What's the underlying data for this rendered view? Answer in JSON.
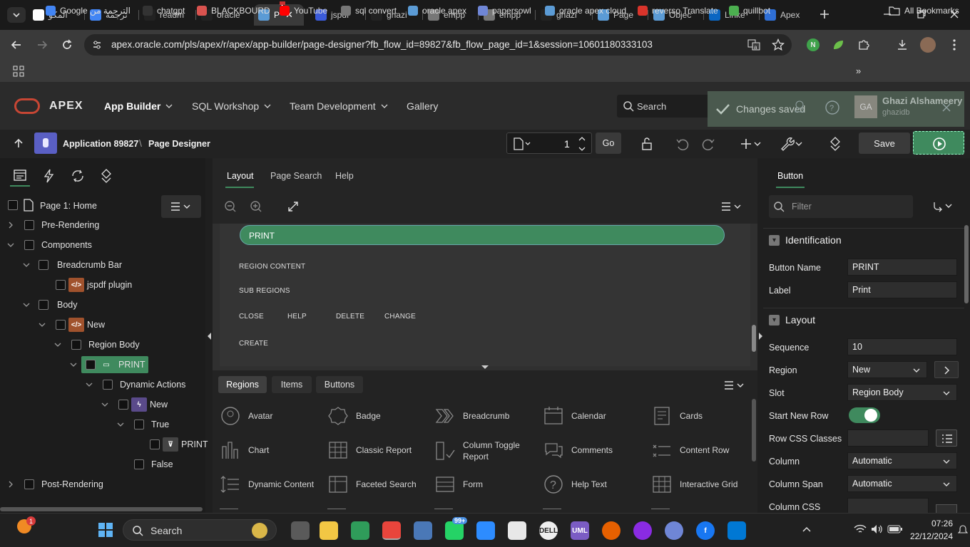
{
  "browser": {
    "tabs": [
      {
        "label": "المكوّ",
        "icon": "page-icon",
        "color": "#ffffff"
      },
      {
        "label": "ترجمة",
        "icon": "google-translate-icon",
        "color": "#4285f4"
      },
      {
        "label": "readm",
        "icon": "github-icon",
        "color": "#222222"
      },
      {
        "label": "oracle",
        "icon": "github-icon",
        "color": "#222222"
      },
      {
        "label": "P",
        "icon": "apex-icon",
        "color": "#5b9bd5"
      },
      {
        "label": "jspdf",
        "icon": "jspdf-icon",
        "color": "#3b5bdb"
      },
      {
        "label": "ghazi",
        "icon": "github-icon",
        "color": "#222222"
      },
      {
        "label": "empp",
        "icon": "globe-icon",
        "color": "#777777"
      },
      {
        "label": "empp",
        "icon": "globe-icon",
        "color": "#777777"
      },
      {
        "label": "ghazi",
        "icon": "github-icon",
        "color": "#222222"
      },
      {
        "label": "Page",
        "icon": "apex-icon",
        "color": "#5b9bd5"
      },
      {
        "label": "Objec",
        "icon": "apex-icon",
        "color": "#5b9bd5"
      },
      {
        "label": "Linke",
        "icon": "linkedin-icon",
        "color": "#0a66c2"
      },
      {
        "label": "Apex",
        "icon": "apex-blue-icon",
        "color": "#2f6fd6"
      }
    ],
    "url": "apex.oracle.com/pls/apex/r/apex/app-builder/page-designer?fb_flow_id=89827&fb_flow_page_id=1&session=10601180333103",
    "bookmarks": [
      {
        "label": "Google الترجمة من",
        "icon": "google-translate-icon",
        "color": "#4285f4"
      },
      {
        "label": "chatgpt",
        "icon": "chatgpt-icon",
        "color": "#333333"
      },
      {
        "label": "BLACKBOURD",
        "icon": "blackboard-icon",
        "color": "#d9534f"
      },
      {
        "label": "YouTube",
        "icon": "youtube-icon",
        "color": "#ff0000"
      },
      {
        "label": "sql convert",
        "icon": "globe-icon",
        "color": "#777777"
      },
      {
        "label": "oracle apex",
        "icon": "apex-icon",
        "color": "#5b9bd5"
      },
      {
        "label": "papersowl",
        "icon": "owl-icon",
        "color": "#6f86d6"
      },
      {
        "label": "oracle apex cloud",
        "icon": "apex-icon",
        "color": "#5b9bd5"
      },
      {
        "label": "reverso Translate",
        "icon": "reverso-icon",
        "color": "#d9342b"
      },
      {
        "label": "quillbot",
        "icon": "quillbot-icon",
        "color": "#4caf50"
      }
    ],
    "all_bookmarks": "All Bookmarks",
    "profile_letter": "N"
  },
  "apex": {
    "logo": "APEX",
    "nav": [
      "App Builder",
      "SQL Workshop",
      "Team Development",
      "Gallery"
    ],
    "search_placeholder": "Search",
    "toast": "Changes saved",
    "user_initials": "GA",
    "user_name": "Ghazi Alshameery",
    "user_ws": "ghazidb",
    "app_label": "Application 89827",
    "breadcrumb_current": "Page Designer",
    "page_number": "1",
    "go_label": "Go",
    "save_label": "Save"
  },
  "tree": {
    "root": "Page 1: Home",
    "nodes": [
      {
        "label": "Pre-Rendering"
      },
      {
        "label": "Components"
      },
      {
        "label": "Breadcrumb Bar"
      },
      {
        "label": "jspdf plugin"
      },
      {
        "label": "Body"
      },
      {
        "label": "New"
      },
      {
        "label": "Region Body"
      },
      {
        "label": "PRINT"
      },
      {
        "label": "Dynamic Actions"
      },
      {
        "label": "New"
      },
      {
        "label": "True"
      },
      {
        "label": "PRINT"
      },
      {
        "label": "False"
      },
      {
        "label": "Post-Rendering"
      }
    ]
  },
  "center": {
    "tabs": [
      "Layout",
      "Page Search",
      "Help"
    ],
    "print_button": "PRINT",
    "labels": [
      "REGION CONTENT",
      "SUB REGIONS",
      "CLOSE",
      "HELP",
      "DELETE",
      "CHANGE",
      "CREATE"
    ],
    "gallery_tabs": [
      "Regions",
      "Items",
      "Buttons"
    ],
    "gallery_items": [
      "Avatar",
      "Badge",
      "Breadcrumb",
      "Calendar",
      "Cards",
      "Chart",
      "Classic Report",
      "Column Toggle Report",
      "Comments",
      "Content Row",
      "Dynamic Content",
      "Faceted Search",
      "Form",
      "Help Text",
      "Interactive Grid"
    ]
  },
  "props": {
    "title": "Button",
    "filter_placeholder": "Filter",
    "sections": [
      "Identification",
      "Layout"
    ],
    "rows": [
      {
        "label": "Button Name",
        "value": "PRINT"
      },
      {
        "label": "Label",
        "value": "Print"
      },
      {
        "label": "Sequence",
        "value": "10"
      },
      {
        "label": "Region",
        "value": "New"
      },
      {
        "label": "Slot",
        "value": "Region Body"
      },
      {
        "label": "Start New Row",
        "value": ""
      },
      {
        "label": "Row CSS Classes",
        "value": ""
      },
      {
        "label": "Column",
        "value": "Automatic"
      },
      {
        "label": "Column Span",
        "value": "Automatic"
      },
      {
        "label": "Column CSS",
        "value": ""
      }
    ]
  },
  "taskbar": {
    "search": "Search",
    "notification_badge": "1",
    "whatsapp_badge": "99+",
    "time": "07:26",
    "date": "22/12/2024"
  },
  "colors": {
    "accent_green": "#3f8a5e",
    "apex_red": "#c74634",
    "tab_active": "#3a3a3a"
  }
}
